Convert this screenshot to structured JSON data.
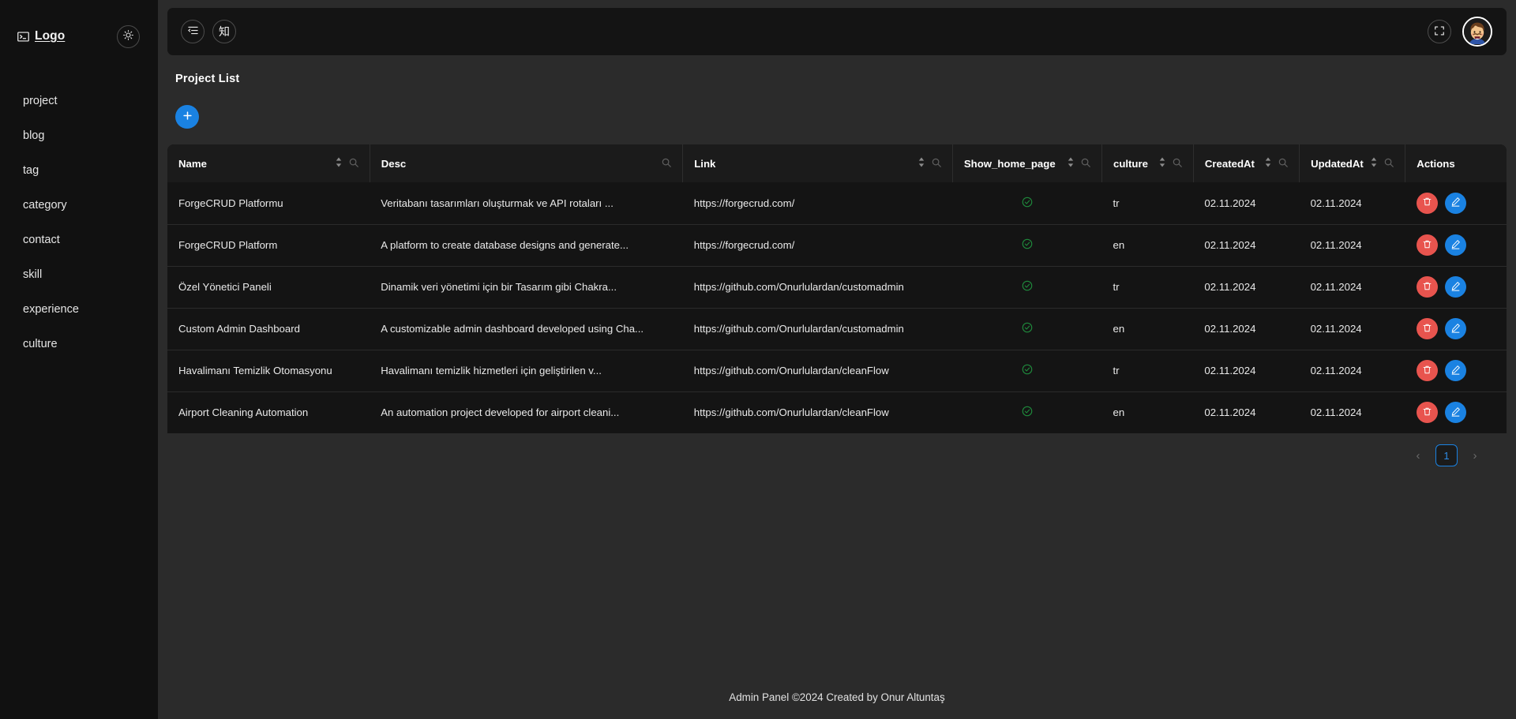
{
  "sidebar": {
    "logo": {
      "text": "Logo",
      "icon": "terminal-icon"
    },
    "theme_toggle": {
      "icon": "sun-icon",
      "label": "Toggle theme"
    },
    "items": [
      {
        "label": "project"
      },
      {
        "label": "blog"
      },
      {
        "label": "tag"
      },
      {
        "label": "category"
      },
      {
        "label": "contact"
      },
      {
        "label": "skill"
      },
      {
        "label": "experience"
      },
      {
        "label": "culture"
      }
    ]
  },
  "topbar": {
    "collapse_icon": "menu-collapse-icon",
    "language_label": "知",
    "fullscreen_icon": "fullscreen-icon",
    "avatar_icon": "user-avatar"
  },
  "page": {
    "title": "Project List",
    "add_label": "+"
  },
  "table": {
    "columns": [
      {
        "key": "name",
        "label": "Name",
        "sortable": true,
        "searchable": true
      },
      {
        "key": "desc",
        "label": "Desc",
        "sortable": false,
        "searchable": true
      },
      {
        "key": "link",
        "label": "Link",
        "sortable": true,
        "searchable": true
      },
      {
        "key": "show_home_page",
        "label": "Show_home_page",
        "sortable": true,
        "searchable": true
      },
      {
        "key": "culture",
        "label": "culture",
        "sortable": true,
        "searchable": true
      },
      {
        "key": "created_at",
        "label": "CreatedAt",
        "sortable": true,
        "searchable": true
      },
      {
        "key": "updated_at",
        "label": "UpdatedAt",
        "sortable": true,
        "searchable": true
      },
      {
        "key": "actions",
        "label": "Actions",
        "sortable": false,
        "searchable": false
      }
    ],
    "rows": [
      {
        "name": "ForgeCRUD Platformu",
        "desc": "Veritabanı tasarımları oluşturmak ve API rotaları ...",
        "link": "https://forgecrud.com/",
        "show_home_page": "checked",
        "culture": "tr",
        "created_at": "02.11.2024",
        "updated_at": "02.11.2024"
      },
      {
        "name": "ForgeCRUD Platform",
        "desc": "A platform to create database designs and generate...",
        "link": "https://forgecrud.com/",
        "show_home_page": "checked",
        "culture": "en",
        "created_at": "02.11.2024",
        "updated_at": "02.11.2024"
      },
      {
        "name": "Özel Yönetici Paneli",
        "desc": "Dinamik veri yönetimi için bir Tasarım gibi Chakra...",
        "link": "https://github.com/Onurlulardan/customadmin",
        "show_home_page": "checked",
        "culture": "tr",
        "created_at": "02.11.2024",
        "updated_at": "02.11.2024"
      },
      {
        "name": "Custom Admin Dashboard",
        "desc": "A customizable admin dashboard developed using Cha...",
        "link": "https://github.com/Onurlulardan/customadmin",
        "show_home_page": "checked",
        "culture": "en",
        "created_at": "02.11.2024",
        "updated_at": "02.11.2024"
      },
      {
        "name": "Havalimanı Temizlik Otomasyonu",
        "desc": "Havalimanı temizlik hizmetleri için geliştirilen v...",
        "link": "https://github.com/Onurlulardan/cleanFlow",
        "show_home_page": "checked",
        "culture": "tr",
        "created_at": "02.11.2024",
        "updated_at": "02.11.2024"
      },
      {
        "name": "Airport Cleaning Automation",
        "desc": "An automation project developed for airport cleani...",
        "link": "https://github.com/Onurlulardan/cleanFlow",
        "show_home_page": "checked",
        "culture": "en",
        "created_at": "02.11.2024",
        "updated_at": "02.11.2024"
      }
    ],
    "row_actions": {
      "delete_label": "Delete",
      "delete_icon": "trash-icon",
      "edit_label": "Edit",
      "edit_icon": "pencil-icon"
    }
  },
  "pagination": {
    "prev_label": "‹",
    "next_label": "›",
    "pages": [
      "1"
    ],
    "current_page": "1"
  },
  "footer": {
    "text": "Admin Panel ©2024 Created by Onur Altuntaş"
  },
  "colors": {
    "accent": "#1a82e2",
    "danger": "#e8544e",
    "success": "#1f8a3c",
    "sidebar_bg": "#111111",
    "panel_bg": "#141414",
    "app_bg": "#2b2b2b"
  }
}
